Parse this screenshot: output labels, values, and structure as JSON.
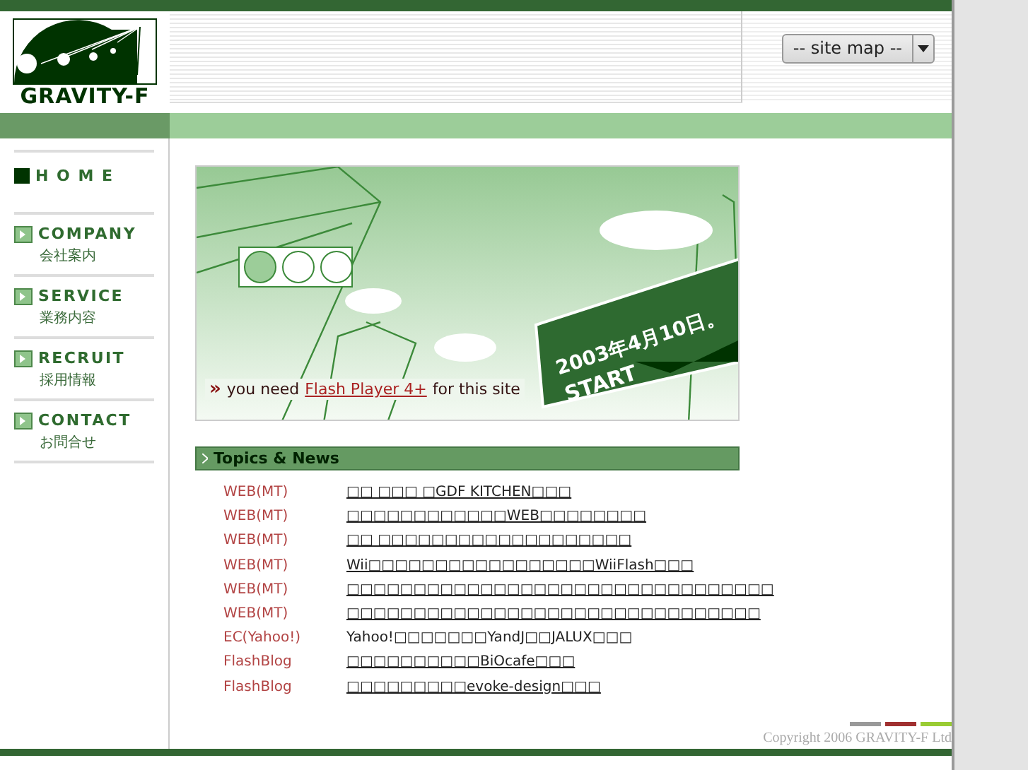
{
  "logo": {
    "text": "GRAVITY-F"
  },
  "site_map": {
    "value": "-- site map --"
  },
  "nav": [
    {
      "kind": "home",
      "label": "H O M E"
    },
    {
      "kind": "section",
      "label": "COMPANY",
      "sub": "会社案内"
    },
    {
      "kind": "section",
      "label": "SERVICE",
      "sub": "業務内容"
    },
    {
      "kind": "section",
      "label": "RECRUIT",
      "sub": "採用情報"
    },
    {
      "kind": "section",
      "label": "CONTACT",
      "sub": "お問合せ"
    }
  ],
  "banner": {
    "sign_date": "2003年4月10日。",
    "sign_word": "START",
    "arrows": "»",
    "notice_before": "you need",
    "notice_link": "Flash Player 4+",
    "notice_after": "for this site"
  },
  "topics": {
    "title": "Topics & News",
    "rows": [
      {
        "category": "WEB(MT)",
        "title": "□□ □□□ □GDF KITCHEN□□□",
        "link": true
      },
      {
        "category": "WEB(MT)",
        "title": "□□□□□□□□□□□□WEB□□□□□□□□",
        "link": true
      },
      {
        "category": "WEB(MT)",
        "title": "□□ □□□□□□□□□□□□□□□□□□□",
        "link": true
      },
      {
        "category": "WEB(MT)",
        "title": "Wii□□□□□□□□□□□□□□□□□WiiFlash□□□",
        "link": true
      },
      {
        "category": "WEB(MT)",
        "title": "□□□□□□□□□□□□□□□□□□□□□□□□□□□□□□□□",
        "link": true
      },
      {
        "category": "WEB(MT)",
        "title": "□□□□□□□□□□□□□□□□□□□□□□□□□□□□□□□",
        "link": true
      },
      {
        "category": "EC(Yahoo!)",
        "title": "Yahoo!□□□□□□□YandJ□□JALUX□□□",
        "link": false
      },
      {
        "category": "FlashBlog",
        "title": "□□□□□□□□□□BiOcafe□□□",
        "link": true
      },
      {
        "category": "FlashBlog",
        "title": "□□□□□□□□□evoke-design□□□",
        "link": true
      }
    ]
  },
  "footer": {
    "copyright": "Copyright 2006 GRAVITY-F Ltd"
  }
}
